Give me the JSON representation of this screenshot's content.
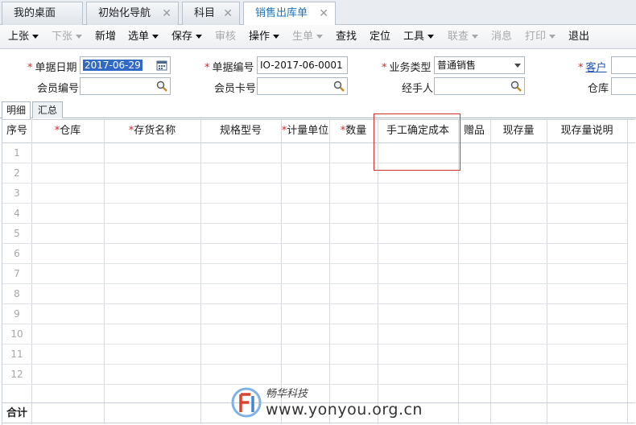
{
  "tabs": [
    {
      "label": "我的桌面",
      "closable": false,
      "active": false
    },
    {
      "label": "初始化导航",
      "closable": true,
      "active": false
    },
    {
      "label": "科目",
      "closable": true,
      "active": false
    },
    {
      "label": "销售出库单",
      "closable": true,
      "active": true
    }
  ],
  "toolbar": {
    "prev": "上张",
    "next": "下张",
    "add": "新增",
    "select": "选单",
    "save": "保存",
    "audit": "审核",
    "operate": "操作",
    "generate": "生单",
    "find": "查找",
    "locate": "定位",
    "tools": "工具",
    "linked": "联查",
    "message": "消息",
    "print": "打印",
    "exit": "退出"
  },
  "form": {
    "doc_date_label": "单据日期",
    "doc_date_value": "2017-06-29",
    "doc_no_label": "单据编号",
    "doc_no_value": "IO-2017-06-0001",
    "biz_type_label": "业务类型",
    "biz_type_value": "普通销售",
    "customer_label": "客户",
    "member_no_label": "会员编号",
    "member_card_label": "会员卡号",
    "handler_label": "经手人",
    "warehouse_label": "仓库"
  },
  "subtabs": [
    "明细",
    "汇总"
  ],
  "grid": {
    "columns": [
      "序号",
      "仓库",
      "存货名称",
      "规格型号",
      "计量单位",
      "数量",
      "手工确定成本",
      "赠品",
      "现存量",
      "现存量说明"
    ],
    "required_columns": [
      "仓库",
      "存货名称",
      "计量单位",
      "数量"
    ],
    "rows": [
      "1",
      "2",
      "3",
      "4",
      "5",
      "6",
      "7",
      "8",
      "9",
      "10",
      "11",
      "12"
    ],
    "total_label": "合计"
  },
  "watermark": {
    "brand": "畅华科技",
    "url": "www.yonyou.org.cn"
  },
  "colors": {
    "active_tab_text": "#1a73b8",
    "required_mark": "#d9232e",
    "selection_bg": "#316ac5",
    "highlight_border": "#d32f2f"
  }
}
